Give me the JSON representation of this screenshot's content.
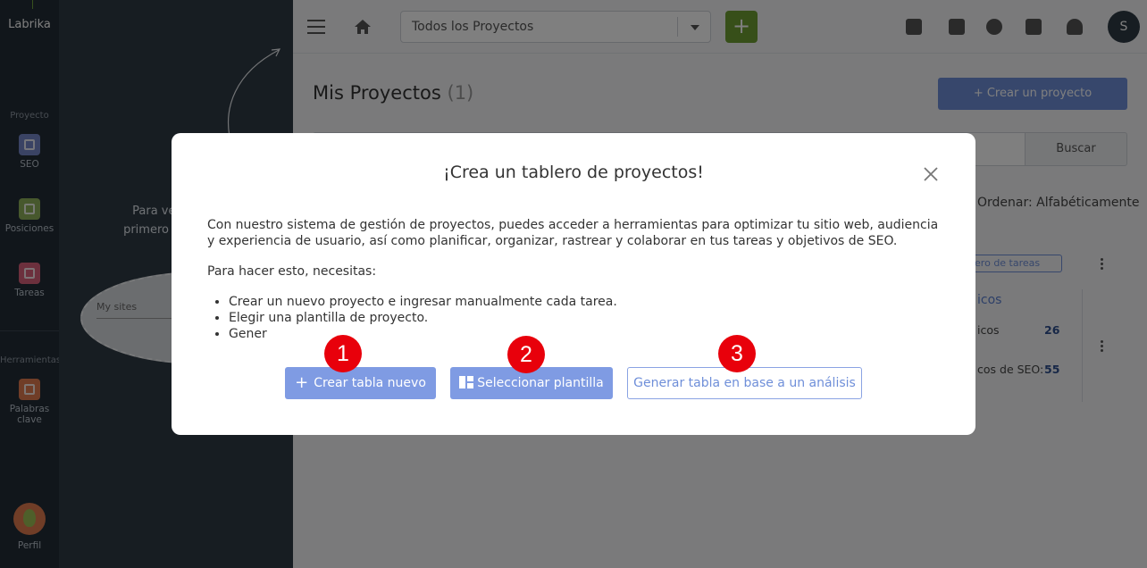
{
  "app": {
    "logo": "Labrika"
  },
  "leftnav": {
    "section_project": "Proyecto",
    "items": [
      {
        "label": "SEO",
        "icon": "seo-icon"
      },
      {
        "label": "Posiciones",
        "icon": "chart-icon"
      },
      {
        "label": "Tareas",
        "icon": "check-icon"
      }
    ],
    "section_tools": "Herramientas",
    "tools": [
      {
        "label": "Palabras clave",
        "icon": "key-icon"
      }
    ],
    "profile_label": "Perfil"
  },
  "panel": {
    "hint_line1": "Para ver la inform",
    "hint_line2": "primero selecciona u",
    "mysites": "My sites"
  },
  "topbar": {
    "project_select_value": "Todos los Proyectos",
    "add_label": "+",
    "user_initial": "S"
  },
  "main": {
    "title": "Mis Proyectos",
    "count": "(1)",
    "create_project": "+ Crear un proyecto",
    "search_button": "Buscar",
    "sort": "Ordenar: Alfabéticamente",
    "board_tag": "blero de tareas",
    "card_link": "icos",
    "stat1_label": "icos",
    "stat1_value": "26",
    "stat2_label": "cos de SEO:",
    "stat2_value": "55"
  },
  "modal": {
    "title": "¡Crea un tablero de proyectos!",
    "intro": "Con nuestro sistema de gestión de proyectos, puedes acceder a herramientas para optimizar tu sitio web, audiencia y experiencia de usuario, así como planificar, organizar, rastrear y colaborar en tus tareas y objetivos de SEO.",
    "need": "Para hacer esto, necesitas:",
    "bullets": [
      "Crear un nuevo proyecto e ingresar manualmente cada tarea.",
      "Elegir una plantilla de proyecto.",
      "Gener"
    ],
    "btn_new": "Crear tabla nuevo",
    "btn_template": "Seleccionar plantilla",
    "btn_analysis": "Generar tabla en base a un análisis",
    "badges": [
      "1",
      "2",
      "3"
    ]
  },
  "colors": {
    "accent": "#7f9be3",
    "brand_green": "#6e9e32",
    "badge_red": "#e8000b"
  }
}
